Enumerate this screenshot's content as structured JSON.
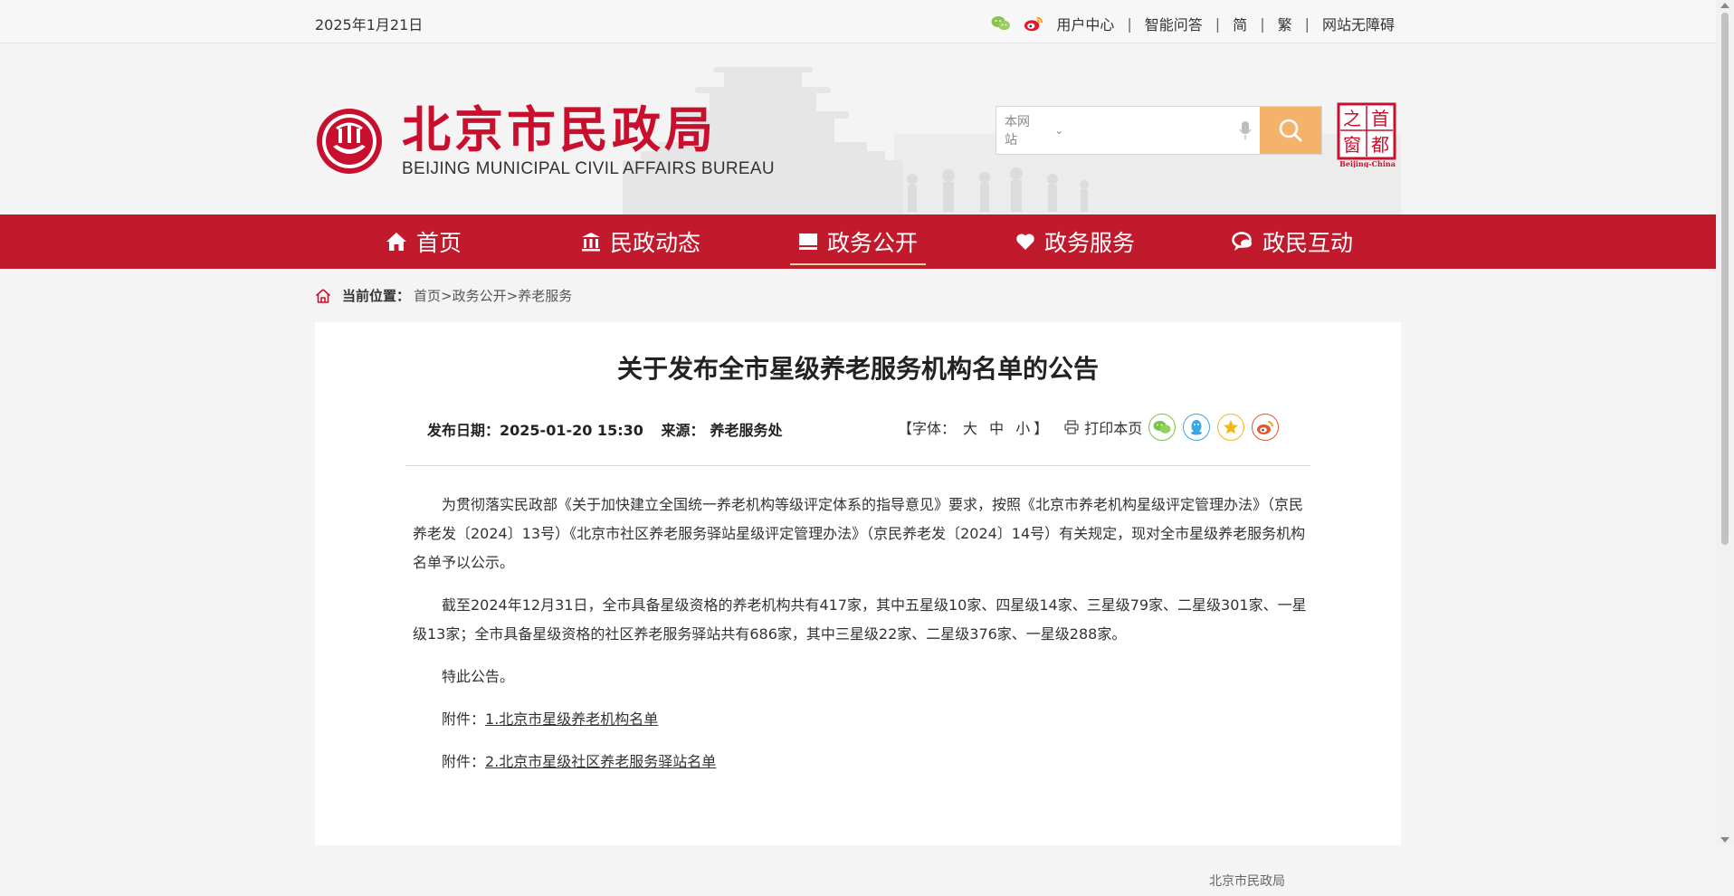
{
  "topbar": {
    "date": "2025年1月21日",
    "icons": [
      "wechat-icon",
      "weibo-icon"
    ],
    "links": [
      "用户中心",
      "智能问答",
      "简",
      "繁",
      "网站无障碍"
    ]
  },
  "header": {
    "logo_cn": "北京市民政局",
    "logo_en": "BEIJING MUNICIPAL CIVIL AFFAIRS BUREAU",
    "search": {
      "scope": "本网站",
      "value": ""
    },
    "capital_badge": {
      "chars": [
        "之",
        "首",
        "窗",
        "都"
      ],
      "caption": "Beijing-China"
    }
  },
  "nav": [
    {
      "label": "首页",
      "icon": "home-icon"
    },
    {
      "label": "民政动态",
      "icon": "bank-icon"
    },
    {
      "label": "政务公开",
      "icon": "list-icon",
      "active": true
    },
    {
      "label": "政务服务",
      "icon": "heart-icon"
    },
    {
      "label": "政民互动",
      "icon": "chat-icon"
    }
  ],
  "breadcrumb": {
    "label": "当前位置：",
    "items": [
      "首页",
      "政务公开",
      "养老服务"
    ],
    "sep": ">"
  },
  "article": {
    "title": "关于发布全市星级养老服务机构名单的公告",
    "date_label": "发布日期：",
    "date": "2025-01-20 15:30",
    "source_label": "来源：",
    "source": "养老服务处",
    "font_label": "【字体：",
    "font_sizes": "大 中 小",
    "font_end": "】",
    "print": "打印本页",
    "share_icons": [
      "wechat-share-icon",
      "qq-share-icon",
      "qzone-share-icon",
      "weibo-share-icon"
    ],
    "paragraphs": [
      "为贯彻落实民政部《关于加快建立全国统一养老机构等级评定体系的指导意见》要求，按照《北京市养老机构星级评定管理办法》（京民养老发〔2024〕13号）《北京市社区养老服务驿站星级评定管理办法》（京民养老发〔2024〕14号）有关规定，现对全市星级养老服务机构名单予以公示。",
      "截至2024年12月31日，全市具备星级资格的养老机构共有417家，其中五星级10家、四星级14家、三星级79家、二星级301家、一星级13家；全市具备星级资格的社区养老服务驿站共有686家，其中三星级22家、二星级376家、一星级288家。",
      "特此公告。"
    ],
    "attachments": [
      {
        "label": "附件：",
        "link": "1.北京市星级养老机构名单"
      },
      {
        "label": "附件：",
        "link": "2.北京市星级社区养老服务驿站名单"
      }
    ],
    "cutoff_text": "北京市民政局"
  },
  "colors": {
    "brand_red": "#c11a2d",
    "search_button": "#f4b26b"
  }
}
